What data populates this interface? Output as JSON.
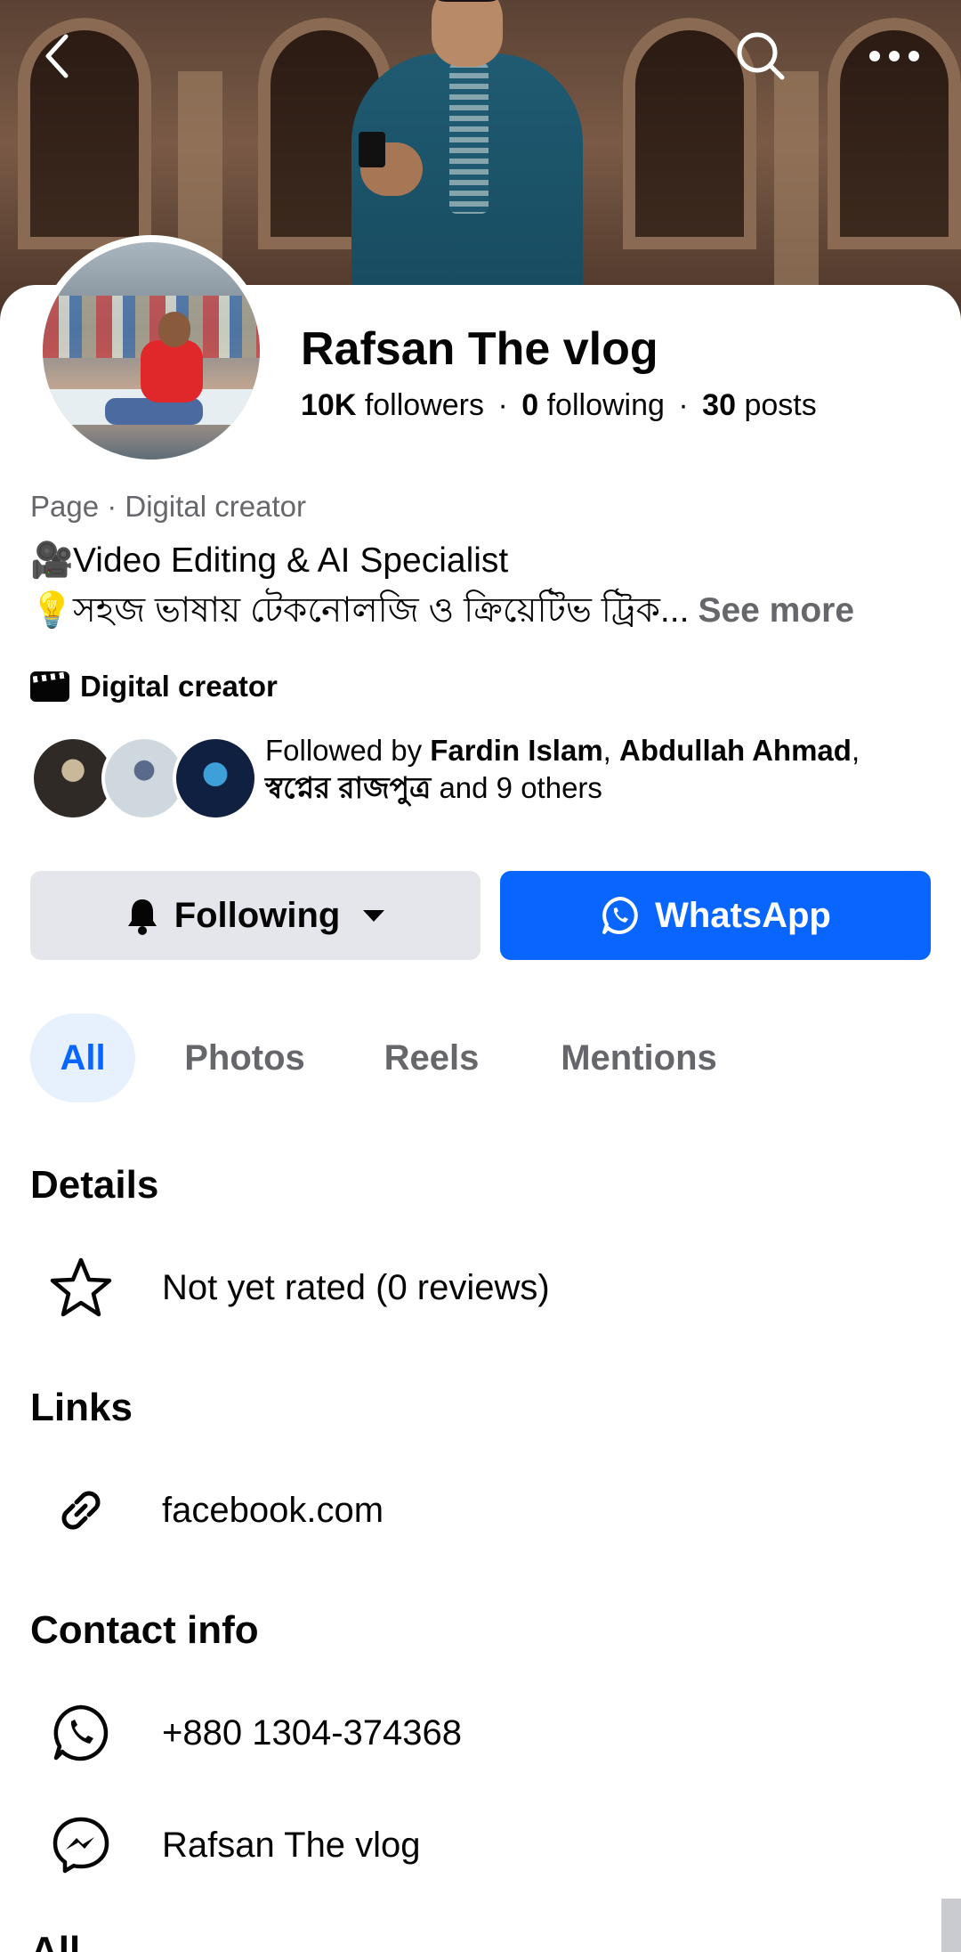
{
  "header": {
    "back_icon": "back-arrow-icon",
    "search_icon": "search-icon",
    "more_icon": "more-horizontal-icon"
  },
  "profile": {
    "name": "Rafsan The vlog",
    "followers_count": "10K",
    "followers_label": "followers",
    "following_count": "0",
    "following_label": "following",
    "posts_count": "30",
    "posts_label": "posts",
    "separator": "·",
    "category": "Page · Digital creator",
    "bio_line1": "Video Editing & AI Specialist",
    "bio_line2": "সহজ ভাষায় টেকনোলজি ও ক্রিয়েটিভ ট্রিক...",
    "bio_emoji1": "🎥",
    "bio_emoji2": "💡",
    "see_more": "See more",
    "creator_label": "Digital creator",
    "followed_by_prefix": "Followed by",
    "followed_name1": "Fardin Islam",
    "followed_sep": ",",
    "followed_name2": "Abdullah Ahmad",
    "followed_name3": "স্বপ্নের রাজপুত্র",
    "followed_suffix": "and 9 others"
  },
  "actions": {
    "following_label": "Following",
    "whatsapp_label": "WhatsApp"
  },
  "tabs": [
    {
      "label": "All",
      "active": true
    },
    {
      "label": "Photos",
      "active": false
    },
    {
      "label": "Reels",
      "active": false
    },
    {
      "label": "Mentions",
      "active": false
    }
  ],
  "details": {
    "title": "Details",
    "rating": "Not yet rated (0 reviews)"
  },
  "links": {
    "title": "Links",
    "url": "facebook.com"
  },
  "contact": {
    "title": "Contact info",
    "phone": "+880 1304-374368",
    "messenger": "Rafsan The vlog"
  },
  "next_section_partial": "All",
  "colors": {
    "accent": "#0866ff",
    "secondary_button": "#e4e6eb",
    "active_tab_bg": "#e7f0fd",
    "muted_text": "#65676b"
  }
}
